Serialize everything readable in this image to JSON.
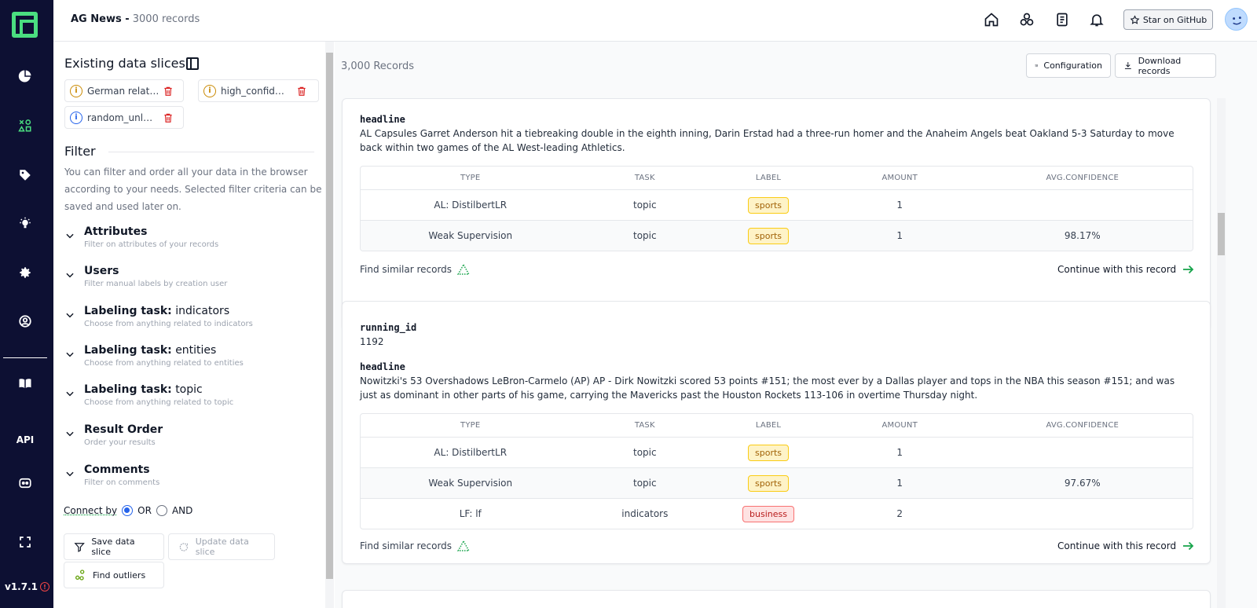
{
  "app": {
    "project_name": "AG News -",
    "record_count_label": "3000 records",
    "version": "v1.7.1",
    "api_label": "API",
    "star_label": "Star on GitHub"
  },
  "sidebar": {
    "slices_title": "Existing data slices",
    "slices": [
      {
        "label": "German relat…",
        "icon": "info-icon",
        "color": "#ca8a04"
      },
      {
        "label": "high_confid…",
        "icon": "info-icon",
        "color": "#ca8a04"
      },
      {
        "label": "random_unl…",
        "icon": "info-icon",
        "color": "#2563eb"
      }
    ],
    "filter_title": "Filter",
    "filter_desc": "You can filter and order all your data in the browser according to your needs. Selected filter criteria can be saved and used later on.",
    "filters": [
      {
        "title": "Attributes",
        "task": "",
        "sub": "Filter on attributes of your records"
      },
      {
        "title": "Users",
        "task": "",
        "sub": "Filter manual labels by creation user"
      },
      {
        "title": "Labeling task:",
        "task": "indicators",
        "sub": "Choose from anything related to indicators"
      },
      {
        "title": "Labeling task:",
        "task": "entities",
        "sub": "Choose from anything related to entities"
      },
      {
        "title": "Labeling task:",
        "task": "topic",
        "sub": "Choose from anything related to topic"
      },
      {
        "title": "Result Order",
        "task": "",
        "sub": "Order your results"
      },
      {
        "title": "Comments",
        "task": "",
        "sub": "Filter on comments"
      }
    ],
    "connect_label": "Connect by",
    "or_label": "OR",
    "and_label": "AND",
    "save_slice": "Save data slice",
    "update_slice": "Update data slice",
    "find_outliers": "Find outliers"
  },
  "main": {
    "records_count": "3,000 Records",
    "configuration": "Configuration",
    "download": "Download records",
    "table_headers": [
      "TYPE",
      "TASK",
      "LABEL",
      "AMOUNT",
      "AVG.CONFIDENCE"
    ],
    "find_similar": "Find similar records",
    "continue": "Continue with this record",
    "card1": {
      "headline_key": "headline",
      "headline": "AL Capsules Garret Anderson hit a tiebreaking double in the eighth inning, Darin Erstad had a three-run homer and the Anaheim Angels beat Oakland 5-3 Saturday to move back within two games of the AL West-leading Athletics.",
      "rows": [
        {
          "type": "AL: DistilbertLR",
          "task": "topic",
          "label": "sports",
          "amount": "1",
          "conf": ""
        },
        {
          "type": "Weak Supervision",
          "task": "topic",
          "label": "sports",
          "amount": "1",
          "conf": "98.17%"
        }
      ]
    },
    "card2": {
      "id_key": "running_id",
      "id_val": "1192",
      "headline_key": "headline",
      "headline": "Nowitzki's 53 Overshadows LeBron-Carmelo (AP) AP - Dirk Nowitzki scored 53 points #151; the most ever by a Dallas player and tops in the NBA this season #151; and was just as dominant in other parts of his game, carrying the Mavericks past the Houston Rockets 113-106 in overtime Thursday night.",
      "rows": [
        {
          "type": "AL: DistilbertLR",
          "task": "topic",
          "label": "sports",
          "amount": "1",
          "conf": ""
        },
        {
          "type": "Weak Supervision",
          "task": "topic",
          "label": "sports",
          "amount": "1",
          "conf": "97.67%"
        },
        {
          "type": "LF: lf",
          "task": "indicators",
          "label": "business",
          "amount": "2",
          "conf": ""
        }
      ]
    }
  }
}
